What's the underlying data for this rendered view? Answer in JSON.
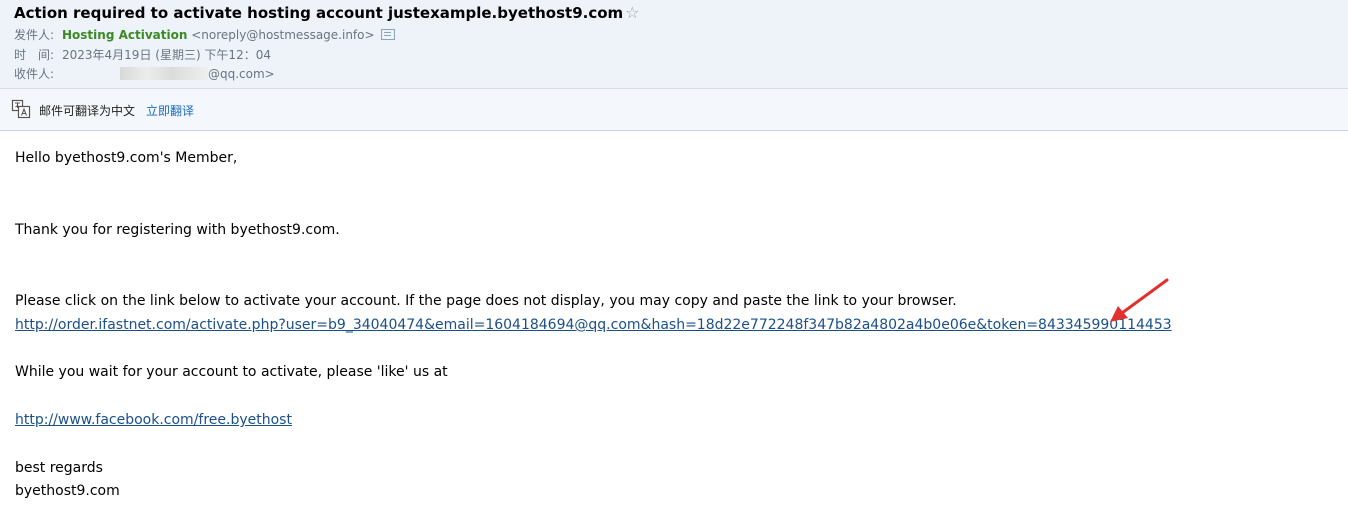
{
  "header": {
    "subject": "Action required to activate hosting account justexample.byethost9.com",
    "star": "☆",
    "from_label": "发件人:",
    "from_name": "Hosting Activation",
    "from_address": "<noreply@hostmessage.info>",
    "time_label": "时　间:",
    "time_value": "2023年4月19日 (星期三) 下午12：04",
    "to_label": "收件人:",
    "to_address_suffix": "@qq.com>"
  },
  "translate": {
    "text": "邮件可翻译为中文",
    "action": "立即翻译"
  },
  "body": {
    "greeting": "Hello byethost9.com's Member,",
    "thanks": "Thank you for registering with byethost9.com.",
    "instruction": "Please click on the link below to activate your account. If the page does not display, you may copy and paste the link to your browser.",
    "activation_link": "http://order.ifastnet.com/activate.php?user=b9_34040474&email=1604184694@qq.com&hash=18d22e772248f347b82a4802a4b0e06e&token=843345990114453",
    "wait": "While you wait for your account to activate, please 'like' us at",
    "facebook_link": "http://www.facebook.com/free.byethost",
    "regards": "best regards",
    "signature": "byethost9.com"
  },
  "colors": {
    "header_bg": "#eef3fa",
    "sender_green": "#3c8a24",
    "link_blue": "#1a4f8b",
    "annotation_red": "#e03030"
  }
}
